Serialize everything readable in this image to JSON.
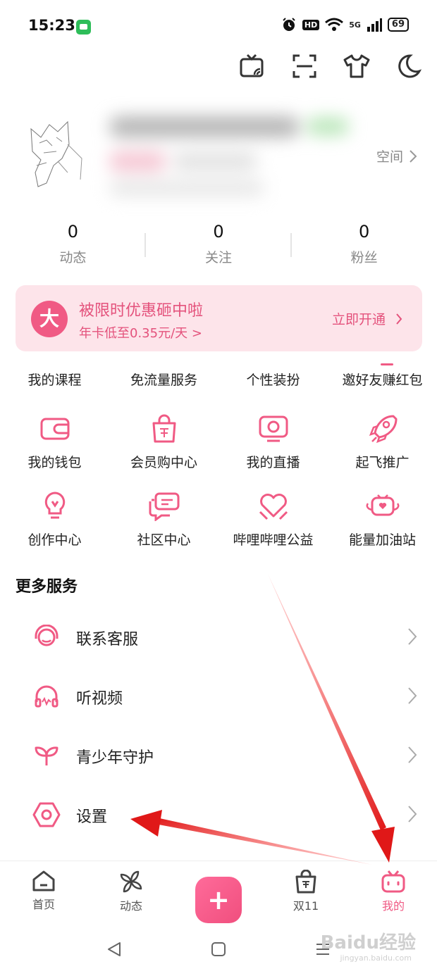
{
  "status_bar": {
    "time": "15:23",
    "hd": "HD",
    "signal": "5G",
    "battery": "69"
  },
  "profile": {
    "space_label": "空间"
  },
  "stats": [
    {
      "value": "0",
      "label": "动态"
    },
    {
      "value": "0",
      "label": "关注"
    },
    {
      "value": "0",
      "label": "粉丝"
    }
  ],
  "vip": {
    "badge": "大",
    "title": "被限时优惠砸中啦",
    "subtitle": "年卡低至0.35元/天 >",
    "action": "立即开通"
  },
  "quick_links": [
    {
      "label": "我的课程"
    },
    {
      "label": "免流量服务"
    },
    {
      "label": "个性装扮"
    },
    {
      "label": "邀好友赚红包"
    }
  ],
  "grid_row_1": [
    {
      "label": "我的钱包",
      "icon": "wallet-icon"
    },
    {
      "label": "会员购中心",
      "icon": "shopping-bag-icon"
    },
    {
      "label": "我的直播",
      "icon": "live-tv-icon"
    },
    {
      "label": "起飞推广",
      "icon": "rocket-icon"
    }
  ],
  "grid_row_2": [
    {
      "label": "创作中心",
      "icon": "lightbulb-icon"
    },
    {
      "label": "社区中心",
      "icon": "chat-bubbles-icon"
    },
    {
      "label": "哔哩哔哩公益",
      "icon": "heart-hands-icon"
    },
    {
      "label": "能量加油站",
      "icon": "energy-station-icon"
    }
  ],
  "more_services": {
    "title": "更多服务",
    "items": [
      {
        "label": "联系客服",
        "icon": "headset-service-icon"
      },
      {
        "label": "听视频",
        "icon": "headphones-icon"
      },
      {
        "label": "青少年守护",
        "icon": "sprout-icon"
      },
      {
        "label": "设置",
        "icon": "settings-hex-icon"
      }
    ]
  },
  "tabs": [
    {
      "label": "首页",
      "icon": "home-icon"
    },
    {
      "label": "动态",
      "icon": "pinwheel-icon"
    },
    {
      "label": "",
      "icon": "plus-icon"
    },
    {
      "label": "双11",
      "icon": "shopping-bag-icon"
    },
    {
      "label": "我的",
      "icon": "tv-face-icon"
    }
  ],
  "watermark": {
    "text": "Baidu经验",
    "sub": "jingyan.baidu.com"
  },
  "colors": {
    "accent": "#f05a84",
    "banner_bg": "#fde4ea",
    "arrow": "#e41e1e"
  }
}
